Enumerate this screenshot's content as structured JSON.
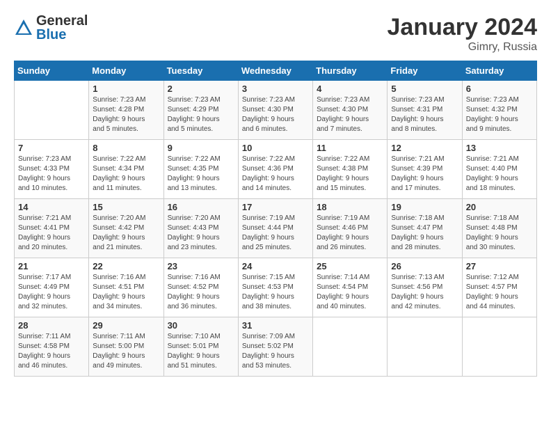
{
  "logo": {
    "general": "General",
    "blue": "Blue"
  },
  "title": "January 2024",
  "subtitle": "Gimry, Russia",
  "days_header": [
    "Sunday",
    "Monday",
    "Tuesday",
    "Wednesday",
    "Thursday",
    "Friday",
    "Saturday"
  ],
  "weeks": [
    [
      {
        "day": "",
        "info": ""
      },
      {
        "day": "1",
        "info": "Sunrise: 7:23 AM\nSunset: 4:28 PM\nDaylight: 9 hours\nand 5 minutes."
      },
      {
        "day": "2",
        "info": "Sunrise: 7:23 AM\nSunset: 4:29 PM\nDaylight: 9 hours\nand 5 minutes."
      },
      {
        "day": "3",
        "info": "Sunrise: 7:23 AM\nSunset: 4:30 PM\nDaylight: 9 hours\nand 6 minutes."
      },
      {
        "day": "4",
        "info": "Sunrise: 7:23 AM\nSunset: 4:30 PM\nDaylight: 9 hours\nand 7 minutes."
      },
      {
        "day": "5",
        "info": "Sunrise: 7:23 AM\nSunset: 4:31 PM\nDaylight: 9 hours\nand 8 minutes."
      },
      {
        "day": "6",
        "info": "Sunrise: 7:23 AM\nSunset: 4:32 PM\nDaylight: 9 hours\nand 9 minutes."
      }
    ],
    [
      {
        "day": "7",
        "info": "Sunrise: 7:23 AM\nSunset: 4:33 PM\nDaylight: 9 hours\nand 10 minutes."
      },
      {
        "day": "8",
        "info": "Sunrise: 7:22 AM\nSunset: 4:34 PM\nDaylight: 9 hours\nand 11 minutes."
      },
      {
        "day": "9",
        "info": "Sunrise: 7:22 AM\nSunset: 4:35 PM\nDaylight: 9 hours\nand 13 minutes."
      },
      {
        "day": "10",
        "info": "Sunrise: 7:22 AM\nSunset: 4:36 PM\nDaylight: 9 hours\nand 14 minutes."
      },
      {
        "day": "11",
        "info": "Sunrise: 7:22 AM\nSunset: 4:38 PM\nDaylight: 9 hours\nand 15 minutes."
      },
      {
        "day": "12",
        "info": "Sunrise: 7:21 AM\nSunset: 4:39 PM\nDaylight: 9 hours\nand 17 minutes."
      },
      {
        "day": "13",
        "info": "Sunrise: 7:21 AM\nSunset: 4:40 PM\nDaylight: 9 hours\nand 18 minutes."
      }
    ],
    [
      {
        "day": "14",
        "info": "Sunrise: 7:21 AM\nSunset: 4:41 PM\nDaylight: 9 hours\nand 20 minutes."
      },
      {
        "day": "15",
        "info": "Sunrise: 7:20 AM\nSunset: 4:42 PM\nDaylight: 9 hours\nand 21 minutes."
      },
      {
        "day": "16",
        "info": "Sunrise: 7:20 AM\nSunset: 4:43 PM\nDaylight: 9 hours\nand 23 minutes."
      },
      {
        "day": "17",
        "info": "Sunrise: 7:19 AM\nSunset: 4:44 PM\nDaylight: 9 hours\nand 25 minutes."
      },
      {
        "day": "18",
        "info": "Sunrise: 7:19 AM\nSunset: 4:46 PM\nDaylight: 9 hours\nand 26 minutes."
      },
      {
        "day": "19",
        "info": "Sunrise: 7:18 AM\nSunset: 4:47 PM\nDaylight: 9 hours\nand 28 minutes."
      },
      {
        "day": "20",
        "info": "Sunrise: 7:18 AM\nSunset: 4:48 PM\nDaylight: 9 hours\nand 30 minutes."
      }
    ],
    [
      {
        "day": "21",
        "info": "Sunrise: 7:17 AM\nSunset: 4:49 PM\nDaylight: 9 hours\nand 32 minutes."
      },
      {
        "day": "22",
        "info": "Sunrise: 7:16 AM\nSunset: 4:51 PM\nDaylight: 9 hours\nand 34 minutes."
      },
      {
        "day": "23",
        "info": "Sunrise: 7:16 AM\nSunset: 4:52 PM\nDaylight: 9 hours\nand 36 minutes."
      },
      {
        "day": "24",
        "info": "Sunrise: 7:15 AM\nSunset: 4:53 PM\nDaylight: 9 hours\nand 38 minutes."
      },
      {
        "day": "25",
        "info": "Sunrise: 7:14 AM\nSunset: 4:54 PM\nDaylight: 9 hours\nand 40 minutes."
      },
      {
        "day": "26",
        "info": "Sunrise: 7:13 AM\nSunset: 4:56 PM\nDaylight: 9 hours\nand 42 minutes."
      },
      {
        "day": "27",
        "info": "Sunrise: 7:12 AM\nSunset: 4:57 PM\nDaylight: 9 hours\nand 44 minutes."
      }
    ],
    [
      {
        "day": "28",
        "info": "Sunrise: 7:11 AM\nSunset: 4:58 PM\nDaylight: 9 hours\nand 46 minutes."
      },
      {
        "day": "29",
        "info": "Sunrise: 7:11 AM\nSunset: 5:00 PM\nDaylight: 9 hours\nand 49 minutes."
      },
      {
        "day": "30",
        "info": "Sunrise: 7:10 AM\nSunset: 5:01 PM\nDaylight: 9 hours\nand 51 minutes."
      },
      {
        "day": "31",
        "info": "Sunrise: 7:09 AM\nSunset: 5:02 PM\nDaylight: 9 hours\nand 53 minutes."
      },
      {
        "day": "",
        "info": ""
      },
      {
        "day": "",
        "info": ""
      },
      {
        "day": "",
        "info": ""
      }
    ]
  ]
}
